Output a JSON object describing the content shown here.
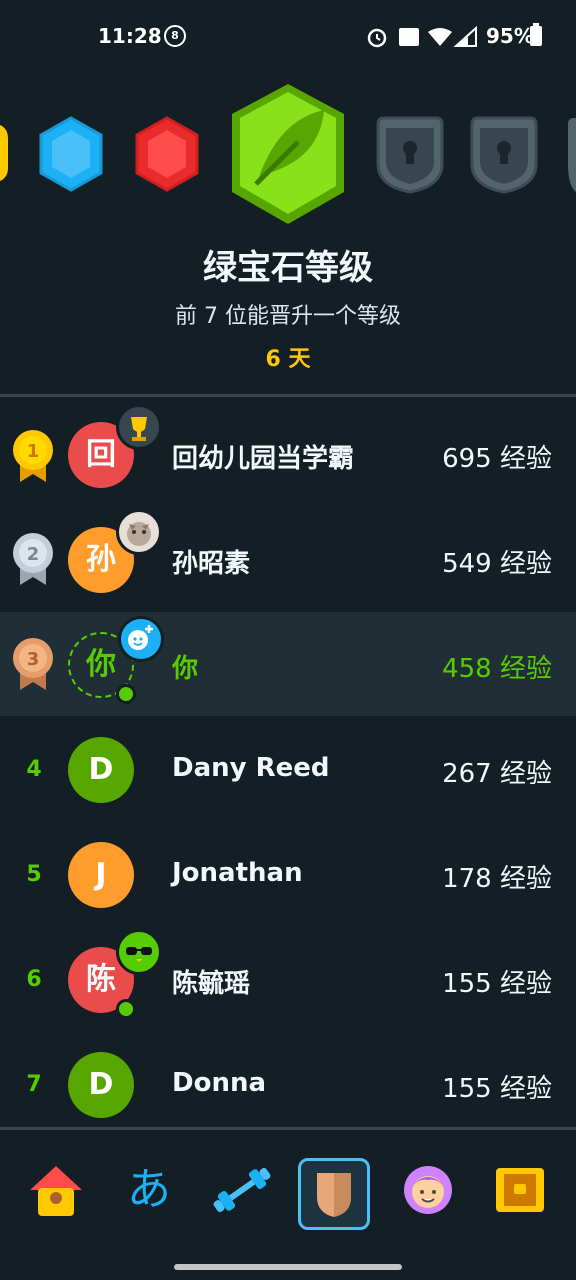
{
  "status_bar": {
    "time": "11:28",
    "battery": "95%"
  },
  "league": {
    "title": "绿宝石等级",
    "subtitle": "前 7 位能晋升一个等级",
    "days_left": "6 天"
  },
  "leaderboard": [
    {
      "rank": "1",
      "avatar_text": "回",
      "name": "回幼儿园当学霸",
      "xp": "695 经验"
    },
    {
      "rank": "2",
      "avatar_text": "孙",
      "name": "孙昭素",
      "xp": "549 经验"
    },
    {
      "rank": "3",
      "avatar_text": "你",
      "name": "你",
      "xp": "458 经验"
    },
    {
      "rank": "4",
      "avatar_text": "D",
      "name": "Dany Reed",
      "xp": "267 经验"
    },
    {
      "rank": "5",
      "avatar_text": "J",
      "name": "Jonathan",
      "xp": "178 经验"
    },
    {
      "rank": "6",
      "avatar_text": "陈",
      "name": "陈毓瑶",
      "xp": "155 经验"
    },
    {
      "rank": "7",
      "avatar_text": "D",
      "name": "Donna",
      "xp": "155 经验"
    }
  ],
  "nav": {
    "items": [
      "home-icon",
      "characters-icon",
      "practice-icon",
      "leaderboard-icon",
      "profile-icon",
      "shop-icon"
    ],
    "characters_glyph": "あ",
    "active": "leaderboard-icon"
  },
  "colors": {
    "background": "#131f24",
    "accent_green": "#58cc02",
    "gold": "#ffc800",
    "highlight_row": "#202f36",
    "nav_active": "#49c0f8"
  }
}
